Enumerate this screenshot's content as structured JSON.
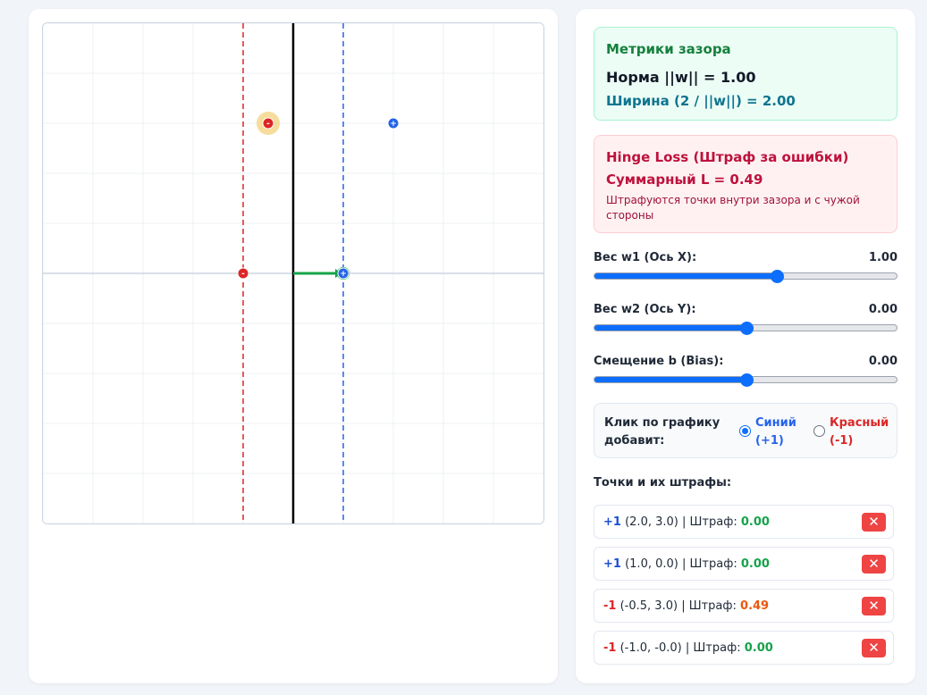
{
  "metrics": {
    "title": "Метрики зазора",
    "norm": "Норма ||w|| = 1.00",
    "width": "Ширина (2 / ||w||) = 2.00"
  },
  "hinge": {
    "title": "Hinge Loss (Штраф за ошибки)",
    "total": "Суммарный L = 0.49",
    "note": "Штрафуются точки внутри зазора и с чужой стороны"
  },
  "sliders": [
    {
      "label": "Вес w1 (Ось X):",
      "value": "1.00",
      "fraction": 0.6
    },
    {
      "label": "Вес w2 (Ось Y):",
      "value": "0.00",
      "fraction": 0.5
    },
    {
      "label": "Смещение b (Bias):",
      "value": "0.00",
      "fraction": 0.5
    }
  ],
  "click": {
    "label": "Клик по графику добавит:",
    "options": [
      {
        "text": "Синий\n(+1)",
        "color": "#2563eb",
        "checked": true
      },
      {
        "text": "Красный\n(-1)",
        "color": "#dc2626",
        "checked": false
      }
    ]
  },
  "points_title": "Точки и их штрафы:",
  "points": [
    {
      "label": "+1",
      "coords": "(2.0, 3.0)",
      "penalty_prefix": "| Штраф:",
      "penalty": "0.00",
      "cls": 1,
      "x": 2.0,
      "y": 3.0,
      "pen": 0.0,
      "icon": "close-icon"
    },
    {
      "label": "+1",
      "coords": "(1.0, 0.0)",
      "penalty_prefix": "| Штраф:",
      "penalty": "0.00",
      "cls": 1,
      "x": 1.0,
      "y": 0.0,
      "pen": 0.0,
      "icon": "close-icon"
    },
    {
      "label": "-1",
      "coords": "(-0.5, 3.0)",
      "penalty_prefix": "| Штраф:",
      "penalty": "0.49",
      "cls": -1,
      "x": -0.5,
      "y": 3.0,
      "pen": 0.49,
      "icon": "close-icon"
    },
    {
      "label": "-1",
      "coords": "(-1.0, -0.0)",
      "penalty_prefix": "| Штраф:",
      "penalty": "0.00",
      "cls": -1,
      "x": -1.0,
      "y": 0.0,
      "pen": 0.0,
      "icon": "close-icon"
    }
  ],
  "plot": {
    "x_range": [
      -5,
      5
    ],
    "y_range": [
      -5,
      5
    ],
    "w": [
      1.0,
      0.0
    ],
    "b": 0.0,
    "colors": {
      "positive": "#2563eb",
      "negative": "#dc2626",
      "boundary": "#000000",
      "weight_vector": "#16a34a",
      "penalty_halo": "#f5d78a",
      "grid": "#eef0f3",
      "axes": "#cbd5e1"
    }
  }
}
